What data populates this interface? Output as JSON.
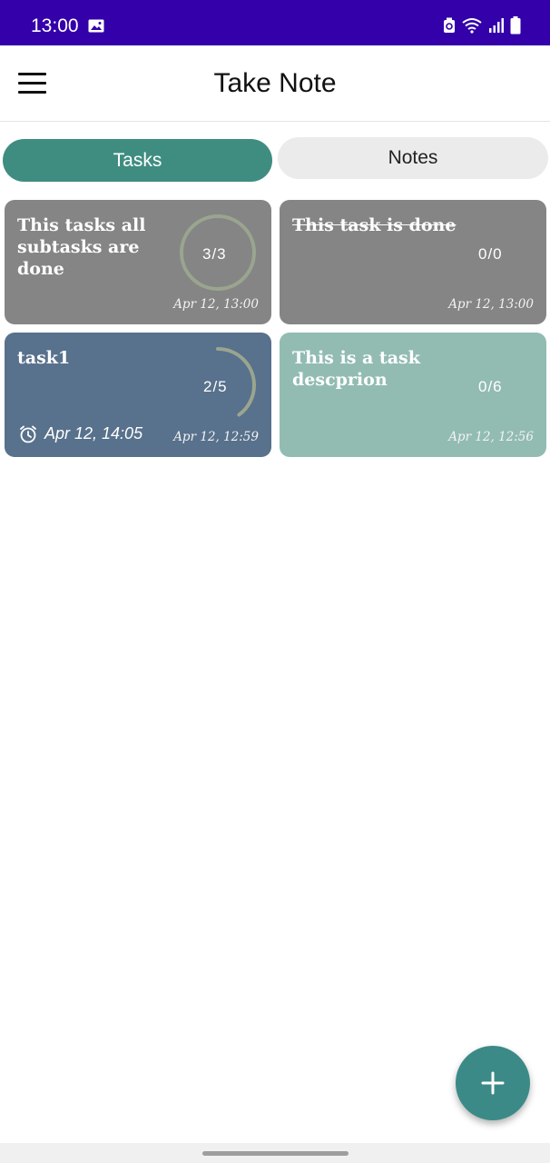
{
  "status_bar": {
    "time": "13:00",
    "icons": [
      "image-icon",
      "battery-saver-icon",
      "wifi-icon",
      "signal-icon",
      "battery-icon"
    ]
  },
  "app_bar": {
    "title": "Take Note",
    "menu_icon": "hamburger-menu-icon"
  },
  "tabs": [
    {
      "label": "Tasks",
      "selected": true
    },
    {
      "label": "Notes",
      "selected": false
    }
  ],
  "tasks": [
    {
      "title": "This tasks all subtasks are done",
      "count": "3/3",
      "progress": 1.0,
      "date": "Apr 12, 13:00",
      "color": "#858585",
      "done": false,
      "reminder": ""
    },
    {
      "title": "This task is done",
      "count": "0/0",
      "progress": 0,
      "date": "Apr 12, 13:00",
      "color": "#858585",
      "done": true,
      "reminder": ""
    },
    {
      "title": "task1",
      "count": "2/5",
      "progress": 0.4,
      "date": "Apr 12, 12:59",
      "color": "#58718c",
      "done": false,
      "reminder": "Apr 12, 14:05"
    },
    {
      "title": "This is a task descprion",
      "count": "0/6",
      "progress": 0,
      "date": "Apr 12, 12:56",
      "color": "#92bcb2",
      "done": false,
      "reminder": ""
    }
  ],
  "fab": {
    "icon": "plus-icon"
  },
  "colors": {
    "status_bar": "#3300aa",
    "accent": "#3f8d80",
    "ring": "#9aa58f"
  }
}
